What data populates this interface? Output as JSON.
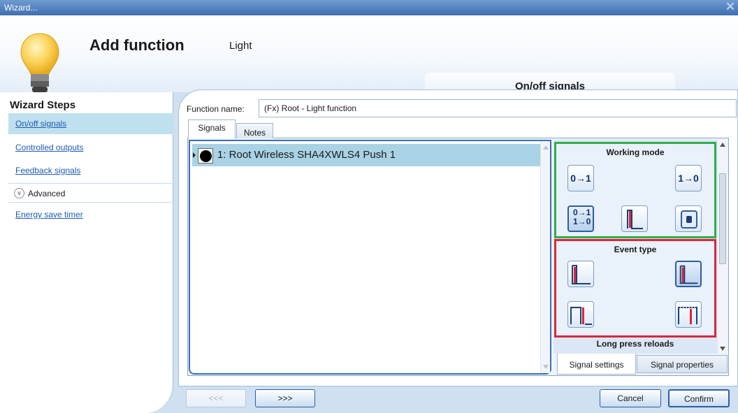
{
  "window": {
    "title": "Wizard...",
    "close_glyph": "✕"
  },
  "header": {
    "title": "Add function",
    "subtitle": "Light",
    "current_step": "On/off signals",
    "icon": "light-bulb-icon"
  },
  "sidebar": {
    "title": "Wizard Steps",
    "items": [
      {
        "label": "On/off signals",
        "selected": true
      },
      {
        "label": "Controlled outputs",
        "selected": false
      },
      {
        "label": "Feedback signals",
        "selected": false
      }
    ],
    "advanced_label": "Advanced",
    "advanced_items": [
      {
        "label": "Energy save timer"
      }
    ]
  },
  "form": {
    "function_name_label": "Function name:",
    "function_name_value": "(Fx) Root - Light function"
  },
  "tabs": [
    {
      "label": "Signals",
      "active": true
    },
    {
      "label": "Notes",
      "active": false
    }
  ],
  "signals": [
    {
      "label": "1: Root Wireless SHA4XWLS4 Push 1",
      "icon": "push-button-icon"
    }
  ],
  "properties": {
    "working_mode": {
      "title": "Working mode",
      "options": [
        {
          "label": "0→1",
          "icon": "rising-edge-icon"
        },
        {
          "label": "1→0",
          "icon": "falling-edge-icon"
        },
        {
          "label": "0→1 1→0",
          "icon": "both-edges-icon",
          "selected": true
        },
        {
          "label": "",
          "icon": "pulse-red-icon"
        },
        {
          "label": "",
          "icon": "device-icon"
        }
      ]
    },
    "event_type": {
      "title": "Event type",
      "options": [
        {
          "icon": "short-press-icon"
        },
        {
          "icon": "long-press-icon",
          "selected": true
        },
        {
          "icon": "pulse-icon"
        },
        {
          "icon": "pulse-hold-icon"
        }
      ]
    },
    "long_press_label": "Long press reloads"
  },
  "property_tabs": [
    {
      "label": "Signal settings",
      "active": true
    },
    {
      "label": "Signal properties",
      "active": false
    }
  ],
  "buttons": {
    "back": "<<<",
    "next": ">>>",
    "cancel": "Cancel",
    "confirm": "Confirm"
  },
  "colors": {
    "accent": "#2d5e9e",
    "working_mode_border": "#2fae4c",
    "event_type_border": "#d8283a",
    "selected_row": "#a9d3e5",
    "signal_red": "#d8283a"
  }
}
